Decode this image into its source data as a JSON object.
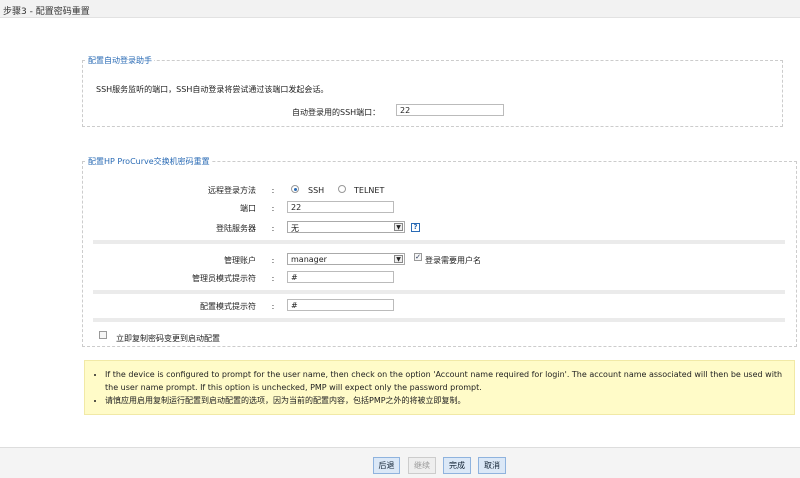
{
  "title": "步骤3 - 配置密码重置",
  "autologin": {
    "legend": "配置自动登录助手",
    "desc": "SSH服务监听的端口，SSH自动登录将尝试通过该端口发起会话。",
    "port_label": "自动登录用的SSH端口：",
    "port_value": "22"
  },
  "hp": {
    "legend": "配置HP ProCurve交换机密码重置",
    "method_label": "远程登录方法",
    "ssh": "SSH",
    "telnet": "TELNET",
    "port_label": "端口",
    "port_value": "22",
    "server_label": "登陆服务器",
    "server_value": "无",
    "help": "?",
    "account_label": "管理账户",
    "account_value": "manager",
    "require_user": "登录需要用户名",
    "admin_prompt_label": "管理员模式提示符",
    "admin_prompt_value": "#",
    "config_prompt_label": "配置模式提示符",
    "config_prompt_value": "#",
    "copy_label": "立即复制密码变更到启动配置",
    "colon": ":"
  },
  "notes": [
    "If the device is configured to prompt for the user name, then check on the option 'Account name required for login'. The account name associated will then be used with the user name prompt. If this option is unchecked, PMP will expect only the password prompt.",
    "请慎应用启用复制运行配置到启动配置的选项，因为当前的配置内容，包括PMP之外的将被立即复制。"
  ],
  "buttons": {
    "back": "后退",
    "continue": "继续",
    "finish": "完成",
    "cancel": "取消"
  }
}
